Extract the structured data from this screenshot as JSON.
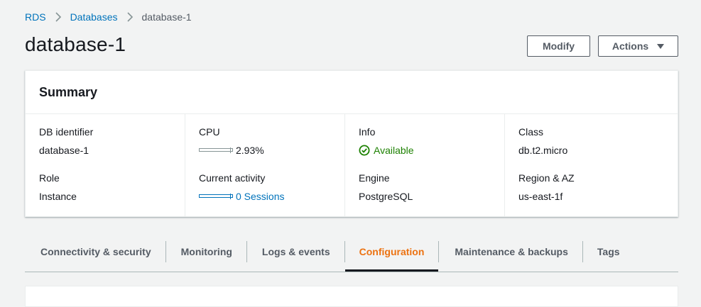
{
  "breadcrumb": {
    "items": [
      "RDS",
      "Databases"
    ],
    "current": "database-1"
  },
  "page": {
    "title": "database-1"
  },
  "buttons": {
    "modify": "Modify",
    "actions": "Actions"
  },
  "summary": {
    "title": "Summary",
    "columns": [
      {
        "label1": "DB identifier",
        "value1": "database-1",
        "label2": "Role",
        "value2": "Instance"
      },
      {
        "label1": "CPU",
        "value1": "2.93%",
        "label2": "Current activity",
        "value2": "0 Sessions"
      },
      {
        "label1": "Info",
        "value1": "Available",
        "label2": "Engine",
        "value2": "PostgreSQL"
      },
      {
        "label1": "Class",
        "value1": "db.t2.micro",
        "label2": "Region & AZ",
        "value2": "us-east-1f"
      }
    ],
    "cpu_utilization": 0.0293,
    "status_color": "#1d8102"
  },
  "tabs": [
    {
      "label": "Connectivity & security"
    },
    {
      "label": "Monitoring"
    },
    {
      "label": "Logs & events"
    },
    {
      "label": "Configuration",
      "active": true
    },
    {
      "label": "Maintenance & backups"
    },
    {
      "label": "Tags"
    }
  ],
  "colors": {
    "link": "#0073bb",
    "active_tab": "#ec7211",
    "background": "#f2f3f3"
  }
}
